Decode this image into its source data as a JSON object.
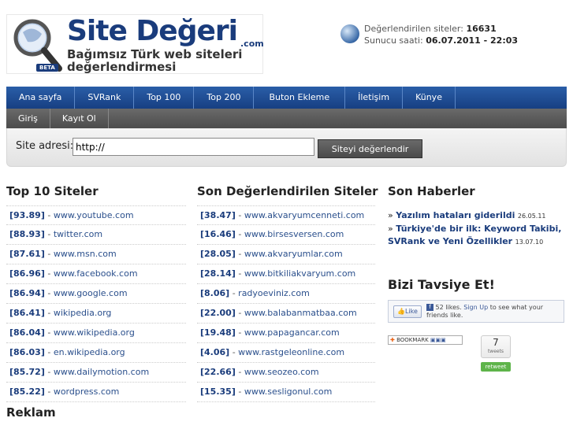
{
  "header": {
    "logo_title": "Site Değeri",
    "logo_tld": ".com",
    "logo_subtitle": "Bağımsız Türk web siteleri değerlendirmesi",
    "beta": "BETA",
    "stats_label_1": "Değerlendirilen siteler:",
    "stats_value_1": "16631",
    "stats_label_2": "Sunucu saati:",
    "stats_value_2": "06.07.2011 - 22:03"
  },
  "nav": [
    "Ana sayfa",
    "SVRank",
    "Top 100",
    "Top 200",
    "Buton Ekleme",
    "İletişim",
    "Künye"
  ],
  "nav2": [
    "Giriş",
    "Kayıt Ol"
  ],
  "search": {
    "label": "Site adresi:",
    "value": "http://",
    "button": "Siteyi değerlendir"
  },
  "top10": {
    "title": "Top 10 Siteler",
    "rows": [
      {
        "score": "[93.89]",
        "site": "www.youtube.com"
      },
      {
        "score": "[88.93]",
        "site": "twitter.com"
      },
      {
        "score": "[87.61]",
        "site": "www.msn.com"
      },
      {
        "score": "[86.96]",
        "site": "www.facebook.com"
      },
      {
        "score": "[86.94]",
        "site": "www.google.com"
      },
      {
        "score": "[86.41]",
        "site": "wikipedia.org"
      },
      {
        "score": "[86.04]",
        "site": "www.wikipedia.org"
      },
      {
        "score": "[86.03]",
        "site": "en.wikipedia.org"
      },
      {
        "score": "[85.72]",
        "site": "www.dailymotion.com"
      },
      {
        "score": "[85.22]",
        "site": "wordpress.com"
      }
    ]
  },
  "recent": {
    "title": "Son Değerlendirilen Siteler",
    "rows": [
      {
        "score": "[38.47]",
        "site": "www.akvaryumcenneti.com"
      },
      {
        "score": "[16.46]",
        "site": "www.birsesversen.com"
      },
      {
        "score": "[28.05]",
        "site": "www.akvaryumlar.com"
      },
      {
        "score": "[28.14]",
        "site": "www.bitkiliakvaryum.com"
      },
      {
        "score": "[8.06]",
        "site": "radyoeviniz.com"
      },
      {
        "score": "[22.00]",
        "site": "www.balabanmatbaa.com"
      },
      {
        "score": "[19.48]",
        "site": "www.papagancar.com"
      },
      {
        "score": "[4.06]",
        "site": "www.rastgeleonline.com"
      },
      {
        "score": "[22.66]",
        "site": "www.seozeo.com"
      },
      {
        "score": "[15.35]",
        "site": "www.sesligonul.com"
      }
    ]
  },
  "news": {
    "title": "Son Haberler",
    "items": [
      {
        "text": "Yazılım hataları giderildi",
        "date": "26.05.11"
      },
      {
        "text": "Türkiye'de bir ilk: Keyword Takibi, SVRank ve Yeni Özellikler",
        "date": "13.07.10"
      }
    ]
  },
  "recommend": {
    "title": "Bizi Tavsiye Et!",
    "like": "Like",
    "likes_count": "52 likes.",
    "signup": "Sign Up",
    "signup_rest": "to see what your friends like.",
    "bookmark": "BOOKMARK",
    "tweet_count": "7",
    "tweet_label": "tweets",
    "retweet": "retweet"
  },
  "ads": {
    "title": "Reklam"
  }
}
